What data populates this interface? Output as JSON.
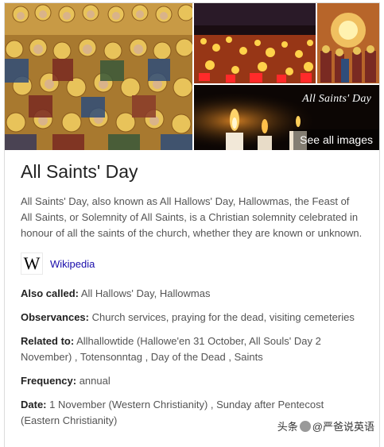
{
  "gallery": {
    "banner_title": "All Saints' Day",
    "see_all_label": "See all images"
  },
  "entity": {
    "title": "All Saints' Day",
    "description": "All Saints' Day, also known as All Hallows' Day, Hallowmas, the Feast of All Saints, or Solemnity of All Saints, is a Christian solemnity celebrated in honour of all the saints of the church, whether they are known or unknown.",
    "source_logo": "W",
    "source_label": "Wikipedia"
  },
  "facts": [
    {
      "label": "Also called:",
      "value": " All Hallows' Day, Hallowmas"
    },
    {
      "label": "Observances:",
      "value": " Church services, praying for the dead, visiting cemeteries"
    },
    {
      "label": "Related to:",
      "value": " Allhallowtide (Hallowe'en 31 October, All Souls' Day 2 November) , Totensonntag , Day of the Dead , Saints"
    },
    {
      "label": "Frequency:",
      "value": " annual"
    },
    {
      "label": "Date:",
      "value": " 1 November (Western Christianity) , Sunday after Pentecost (Eastern Christianity)"
    }
  ],
  "watermark": {
    "prefix": "头条",
    "text": "@严爸说英语"
  },
  "colors": {
    "link": "#1a0dab",
    "title": "#222222",
    "body": "#545454"
  }
}
